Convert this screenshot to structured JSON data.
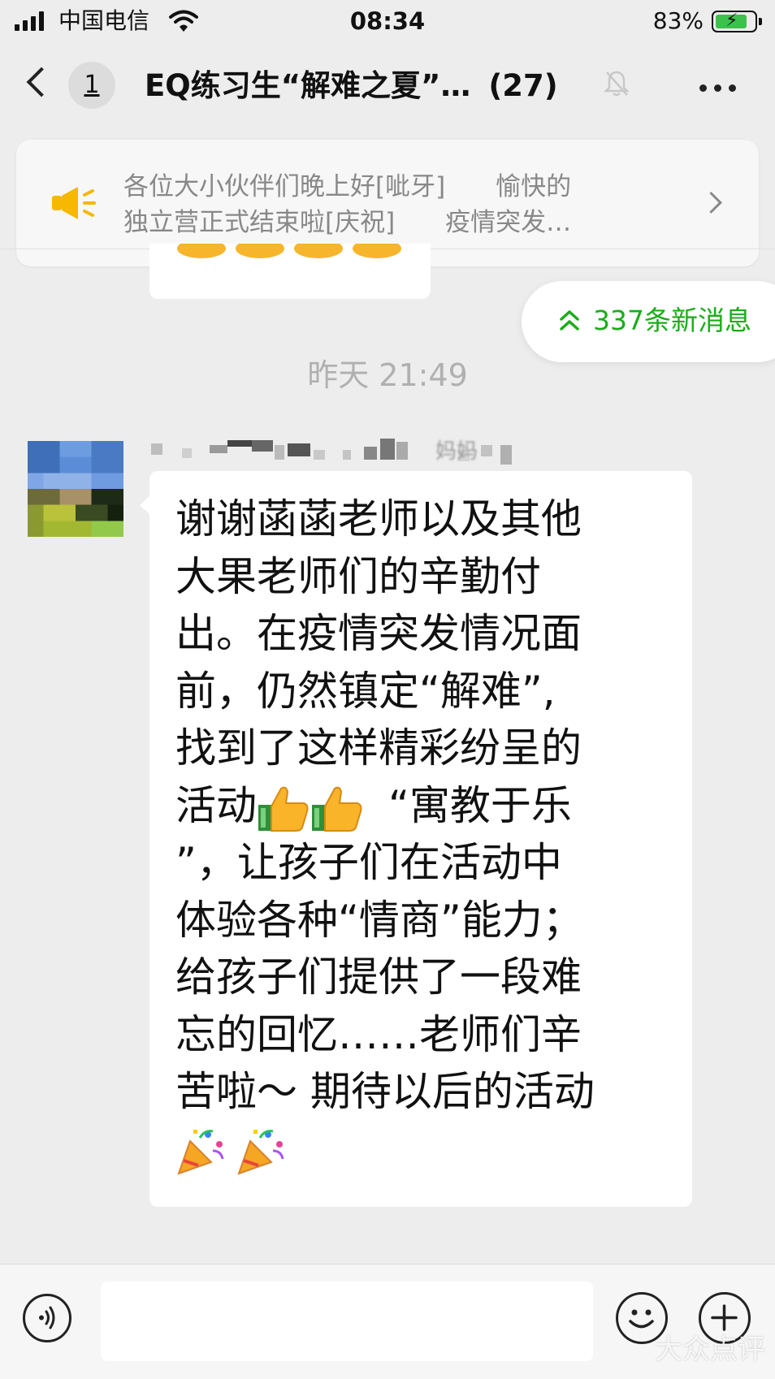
{
  "status_bar": {
    "carrier": "中国电信",
    "time": "08:34",
    "battery": "83%",
    "battery_level": 0.83,
    "signal_icon": "cellular-signal-icon",
    "wifi_icon": "wifi-icon",
    "battery_icon": "battery-charging-icon"
  },
  "nav": {
    "back_icon": "chevron-left-icon",
    "unread_badge": "1",
    "title": "EQ练习生“解难之夏”…",
    "member_count": "(27)",
    "mute_icon": "bell-muted-icon",
    "more_icon": "more-dots-icon"
  },
  "announcement": {
    "icon": "megaphone-icon",
    "line1": "各位大小伙伴们晚上好[呲牙]　　愉快的",
    "line2": "独立营正式结束啦[庆祝]　　疫情突发…",
    "arrow_icon": "chevron-right-icon"
  },
  "new_messages": {
    "icon": "double-chevron-up-icon",
    "label": "337条新消息"
  },
  "chat": {
    "timestamp": "昨天 21:49",
    "sender_name": "妈妈",
    "message_lines": [
      "谢谢菡菡老师以及其他",
      "大果老师们的辛勤付",
      "出。在疫情突发情况面",
      "前，仍然镇定“解难”,",
      "找到了这样精彩纷呈的",
      "活动",
      "“寓教于乐",
      "”，让孩子们在活动中",
      "体验各种“情商”能力；",
      "给孩子们提供了一段难",
      "忘的回忆……老师们辛",
      "苦啦～ 期待以后的活动"
    ],
    "emoji_thumbs": "thumbs-up-emoji",
    "emoji_party": "party-popper-emoji"
  },
  "input_bar": {
    "voice_icon": "voice-icon",
    "emoji_icon": "smiley-icon",
    "plus_icon": "plus-circle-icon"
  },
  "watermark": "大众点评",
  "colors": {
    "background": "#ededed",
    "accent_green": "#1aad19",
    "megaphone": "#f6b800"
  }
}
